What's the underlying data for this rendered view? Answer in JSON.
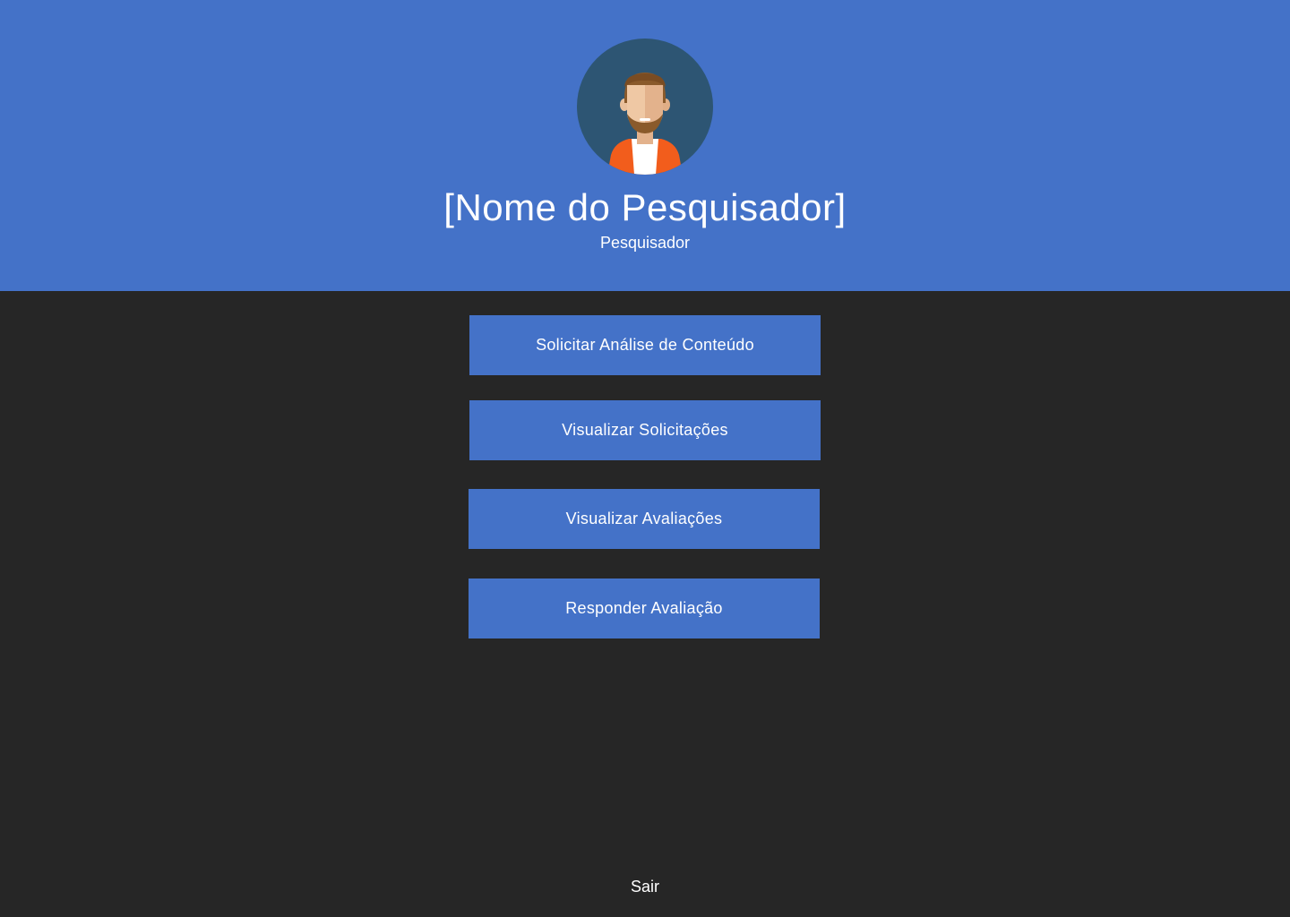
{
  "header": {
    "background_color": "#4472c8",
    "avatar_icon": "user-avatar-icon",
    "user_name": "[Nome do Pesquisador]",
    "user_role": "Pesquisador"
  },
  "menu": {
    "button_color": "#4472c8",
    "buttons": [
      {
        "label": "Solicitar Análise de Conteúdo"
      },
      {
        "label": "Visualizar Solicitações"
      },
      {
        "label": "Visualizar Avaliações"
      },
      {
        "label": "Responder Avaliação"
      }
    ]
  },
  "footer": {
    "logout_label": "Sair"
  },
  "colors": {
    "page_background": "#262626",
    "text": "#ffffff"
  }
}
